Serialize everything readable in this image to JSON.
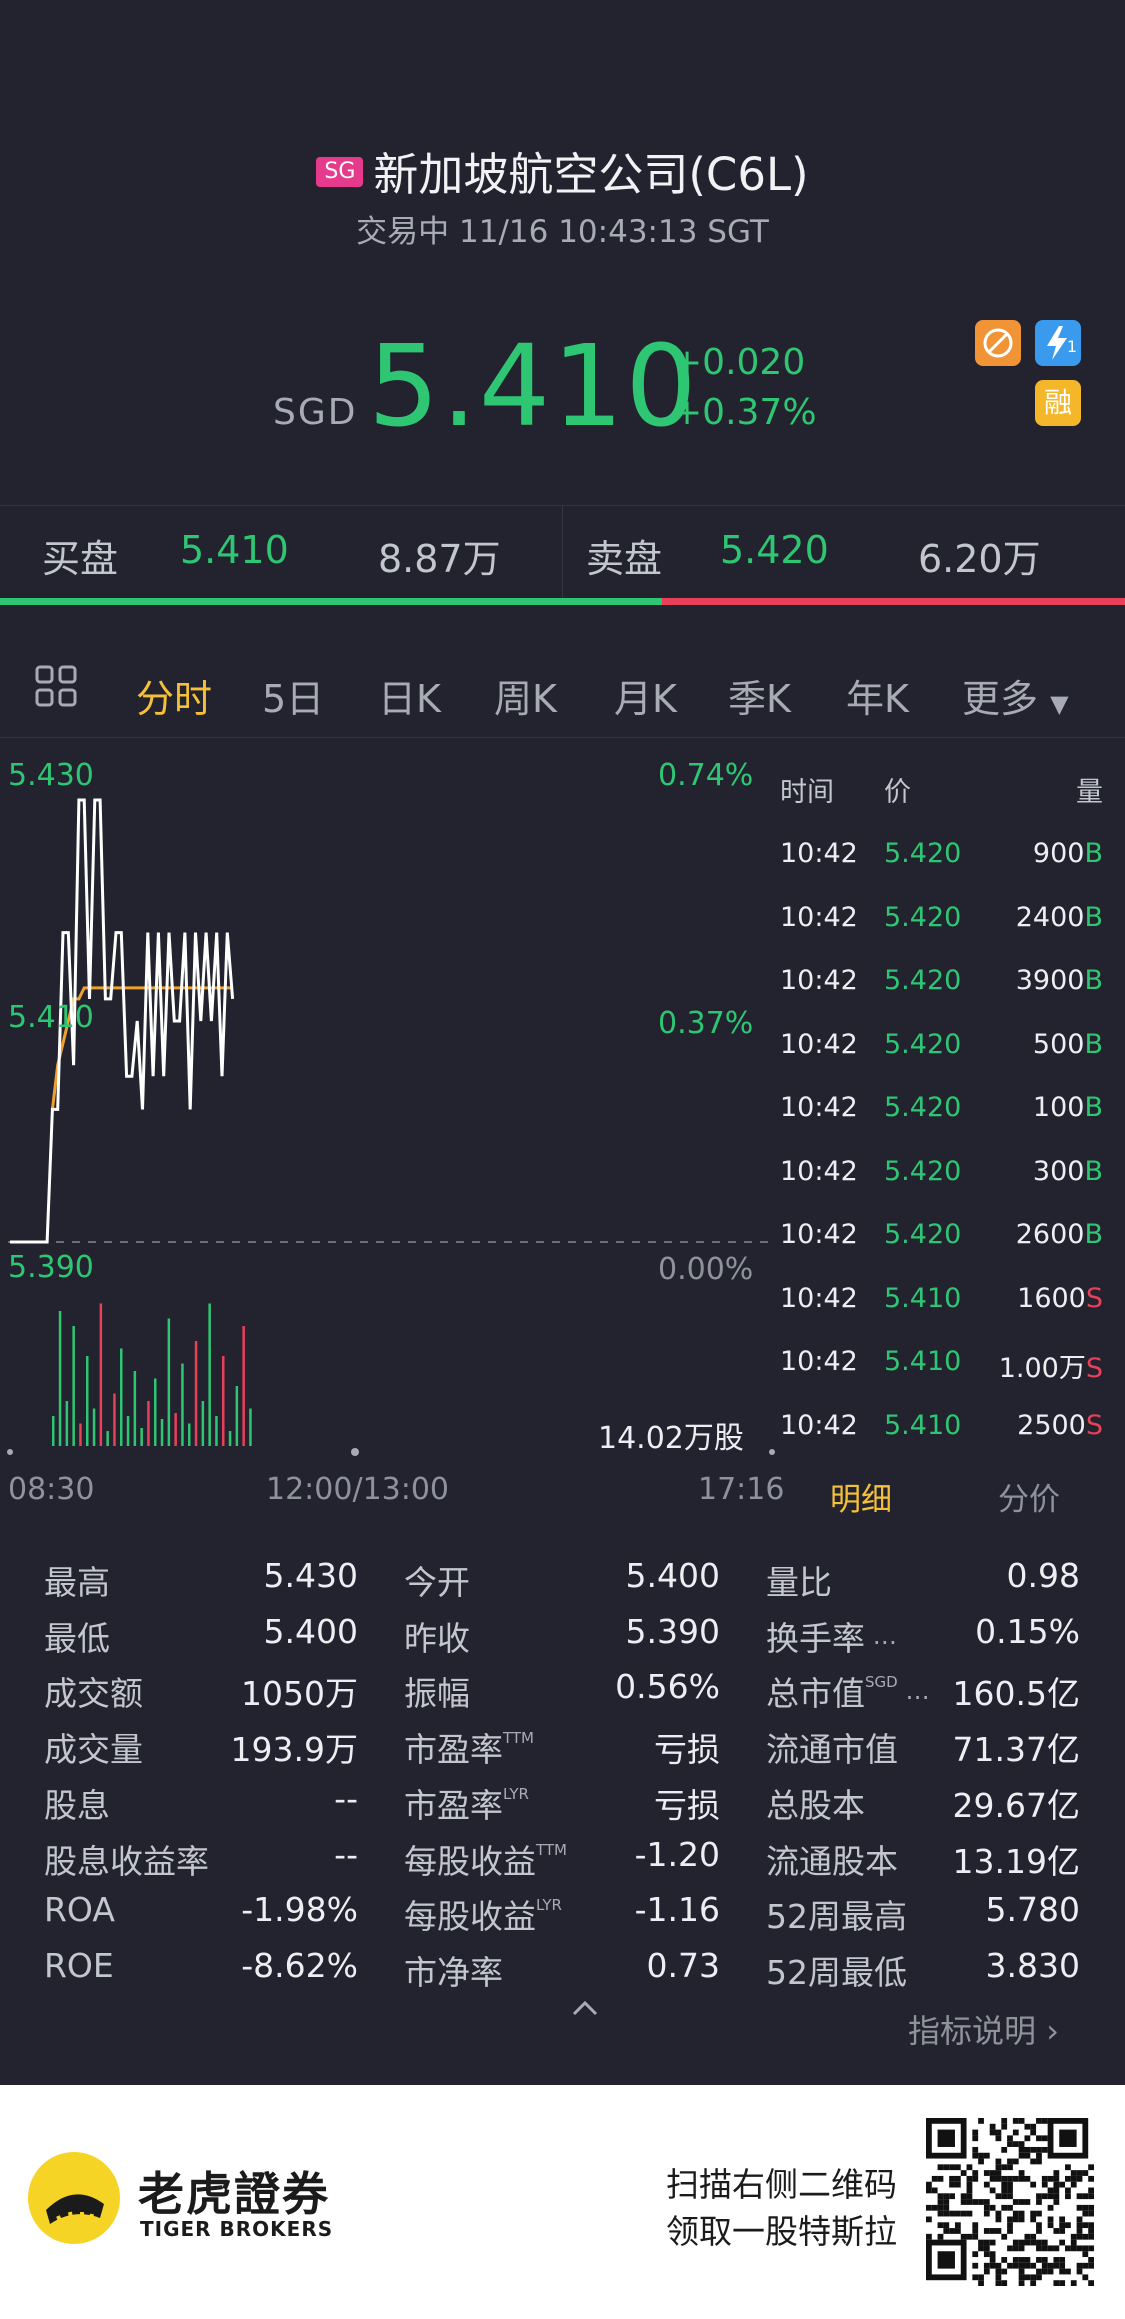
{
  "header": {
    "market_badge": "SG",
    "title": "新加坡航空公司(C6L)",
    "status": "交易中 11/16 10:43:13 SGT",
    "currency": "SGD",
    "price": "5.410",
    "change_abs": "+0.020",
    "change_pct": "+0.37%",
    "icons": {
      "flash_sub": "1",
      "margin": "融"
    }
  },
  "book": {
    "bid_label": "买盘",
    "bid_price": "5.410",
    "bid_vol": "8.87万",
    "ask_label": "卖盘",
    "ask_price": "5.420",
    "ask_vol": "6.20万"
  },
  "tabs": [
    {
      "label": "分时"
    },
    {
      "label": "5日"
    },
    {
      "label": "日K"
    },
    {
      "label": "周K"
    },
    {
      "label": "月K"
    },
    {
      "label": "季K"
    },
    {
      "label": "年K"
    },
    {
      "label": "更多"
    }
  ],
  "chart": {
    "y_high": "5.430",
    "y_mid": "5.410",
    "y_low": "5.390",
    "pct_high": "0.74%",
    "pct_mid": "0.37%",
    "pct_low": "0.00%",
    "volume_label": "14.02万股",
    "x_start": "08:30",
    "x_mid": "12:00/13:00",
    "x_end": "17:16"
  },
  "chart_data": {
    "type": "line",
    "ylim": [
      5.39,
      5.43
    ],
    "price_series": [
      5.39,
      5.39,
      5.39,
      5.39,
      5.39,
      5.39,
      5.39,
      5.39,
      5.402,
      5.402,
      5.418,
      5.418,
      5.406,
      5.43,
      5.43,
      5.412,
      5.43,
      5.43,
      5.412,
      5.412,
      5.418,
      5.418,
      5.405,
      5.405,
      5.41,
      5.402,
      5.418,
      5.405,
      5.418,
      5.405,
      5.418,
      5.41,
      5.41,
      5.418,
      5.402,
      5.418,
      5.41,
      5.418,
      5.41,
      5.418,
      5.405,
      5.418,
      5.412
    ],
    "avg_series": [
      null,
      null,
      null,
      null,
      null,
      null,
      null,
      null,
      5.402,
      5.406,
      5.408,
      5.41,
      5.412,
      5.412,
      5.413,
      5.413,
      5.413,
      5.413,
      5.413,
      5.413,
      5.413,
      5.413,
      5.413,
      5.413,
      5.413,
      5.413,
      5.413,
      5.413,
      5.413,
      5.413,
      5.413,
      5.413,
      5.413,
      5.413,
      5.413,
      5.413,
      5.413,
      5.413,
      5.413,
      5.413,
      5.413,
      5.413,
      5.413
    ],
    "volume_bars": [
      {
        "v": 0.2,
        "c": "g"
      },
      {
        "v": 0.9,
        "c": "g"
      },
      {
        "v": 0.3,
        "c": "g"
      },
      {
        "v": 0.8,
        "c": "g"
      },
      {
        "v": 0.15,
        "c": "r"
      },
      {
        "v": 0.6,
        "c": "g"
      },
      {
        "v": 0.25,
        "c": "g"
      },
      {
        "v": 0.95,
        "c": "r"
      },
      {
        "v": 0.1,
        "c": "g"
      },
      {
        "v": 0.35,
        "c": "r"
      },
      {
        "v": 0.65,
        "c": "g"
      },
      {
        "v": 0.2,
        "c": "g"
      },
      {
        "v": 0.5,
        "c": "g"
      },
      {
        "v": 0.12,
        "c": "g"
      },
      {
        "v": 0.3,
        "c": "r"
      },
      {
        "v": 0.45,
        "c": "g"
      },
      {
        "v": 0.18,
        "c": "g"
      },
      {
        "v": 0.85,
        "c": "g"
      },
      {
        "v": 0.22,
        "c": "r"
      },
      {
        "v": 0.55,
        "c": "g"
      },
      {
        "v": 0.15,
        "c": "g"
      },
      {
        "v": 0.7,
        "c": "r"
      },
      {
        "v": 0.3,
        "c": "g"
      },
      {
        "v": 0.95,
        "c": "g"
      },
      {
        "v": 0.2,
        "c": "g"
      },
      {
        "v": 0.6,
        "c": "r"
      },
      {
        "v": 0.1,
        "c": "g"
      },
      {
        "v": 0.4,
        "c": "g"
      },
      {
        "v": 0.8,
        "c": "r"
      },
      {
        "v": 0.25,
        "c": "g"
      }
    ]
  },
  "trades": {
    "header": {
      "time": "时间",
      "price": "价",
      "vol": "量"
    },
    "rows": [
      {
        "time": "10:42",
        "price": "5.420",
        "vol": "900",
        "side": "B"
      },
      {
        "time": "10:42",
        "price": "5.420",
        "vol": "2400",
        "side": "B"
      },
      {
        "time": "10:42",
        "price": "5.420",
        "vol": "3900",
        "side": "B"
      },
      {
        "time": "10:42",
        "price": "5.420",
        "vol": "500",
        "side": "B"
      },
      {
        "time": "10:42",
        "price": "5.420",
        "vol": "100",
        "side": "B"
      },
      {
        "time": "10:42",
        "price": "5.420",
        "vol": "300",
        "side": "B"
      },
      {
        "time": "10:42",
        "price": "5.420",
        "vol": "2600",
        "side": "B"
      },
      {
        "time": "10:42",
        "price": "5.410",
        "vol": "1600",
        "side": "S"
      },
      {
        "time": "10:42",
        "price": "5.410",
        "vol": "1.00万",
        "side": "S"
      },
      {
        "time": "10:42",
        "price": "5.410",
        "vol": "2500",
        "side": "S"
      }
    ],
    "tab_detail": "明细",
    "tab_price": "分价"
  },
  "stats": {
    "col1": [
      {
        "k": "最高",
        "v": "5.430"
      },
      {
        "k": "最低",
        "v": "5.400"
      },
      {
        "k": "成交额",
        "v": "1050万"
      },
      {
        "k": "成交量",
        "v": "193.9万"
      },
      {
        "k": "股息",
        "v": "--"
      },
      {
        "k": "股息收益率",
        "v": "--"
      },
      {
        "k": "ROA",
        "v": "-1.98%"
      },
      {
        "k": "ROE",
        "v": "-8.62%"
      }
    ],
    "col2": [
      {
        "k": "今开",
        "v": "5.400",
        "sup": ""
      },
      {
        "k": "昨收",
        "v": "5.390",
        "sup": ""
      },
      {
        "k": "振幅",
        "v": "0.56%",
        "sup": ""
      },
      {
        "k": "市盈率",
        "v": "亏损",
        "sup": "TTM"
      },
      {
        "k": "市盈率",
        "v": "亏损",
        "sup": "LYR"
      },
      {
        "k": "每股收益",
        "v": "-1.20",
        "sup": "TTM"
      },
      {
        "k": "每股收益",
        "v": "-1.16",
        "sup": "LYR"
      },
      {
        "k": "市净率",
        "v": "0.73",
        "sup": ""
      }
    ],
    "col3": [
      {
        "k": "量比",
        "v": "0.98",
        "sup": ""
      },
      {
        "k": "换手率",
        "v": "0.15%",
        "sup": ""
      },
      {
        "k": "总市值",
        "v": "160.5亿",
        "sup": "SGD"
      },
      {
        "k": "流通市值",
        "v": "71.37亿",
        "sup": ""
      },
      {
        "k": "总股本",
        "v": "29.67亿",
        "sup": ""
      },
      {
        "k": "流通股本",
        "v": "13.19亿",
        "sup": ""
      },
      {
        "k": "52周最高",
        "v": "5.780",
        "sup": ""
      },
      {
        "k": "52周最低",
        "v": "3.830",
        "sup": ""
      }
    ],
    "indicator_link": "指标说明"
  },
  "footer": {
    "brand_cn": "老虎證券",
    "brand_en": "TIGER BROKERS",
    "promo_line1": "扫描右侧二维码",
    "promo_line2": "领取一股特斯拉"
  },
  "colors": {
    "up": "#2fc673",
    "down": "#e9405a",
    "accent": "#f6c13a",
    "avg": "#f0a030",
    "bg": "#22232e"
  }
}
